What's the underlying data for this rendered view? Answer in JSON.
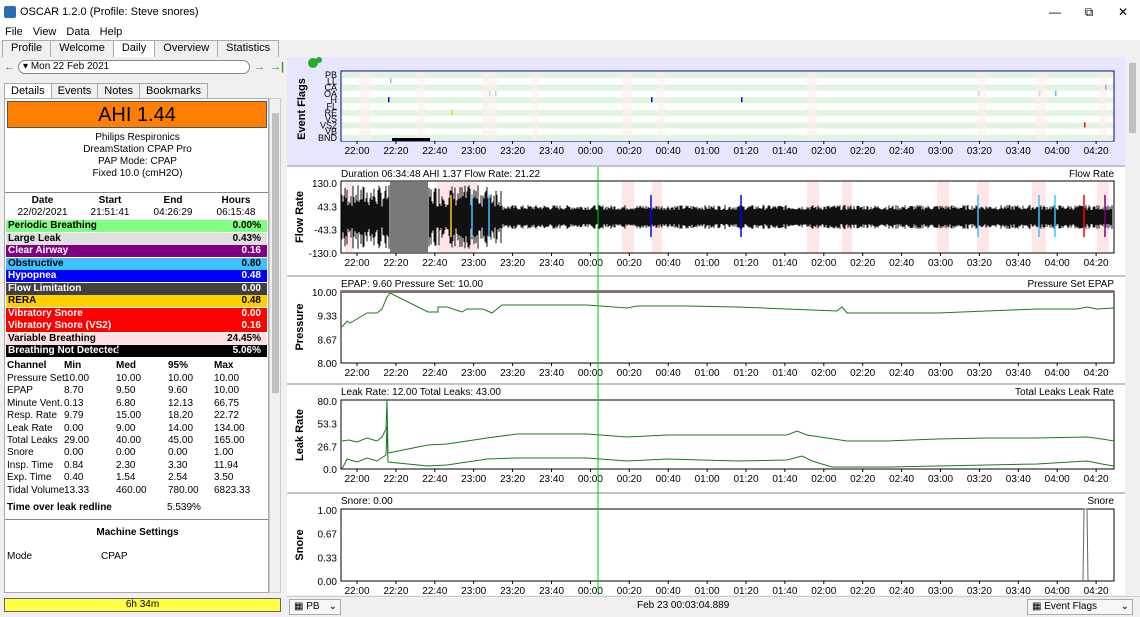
{
  "window": {
    "title": "OSCAR 1.2.0 (Profile: Steve snores)",
    "minimize": "—",
    "maximize": "⧉",
    "close": "✕"
  },
  "menu": [
    "File",
    "View",
    "Data",
    "Help"
  ],
  "main_tabs": [
    "Profile",
    "Welcome",
    "Daily",
    "Overview",
    "Statistics"
  ],
  "date_nav": {
    "back": "←",
    "date": "Mon 22 Feb 2021",
    "forward": "→",
    "last": "→|"
  },
  "detail_tabs": [
    "Details",
    "Events",
    "Notes",
    "Bookmarks"
  ],
  "ahi_label": "AHI 1.44",
  "machine": {
    "brand": "Philips Respironics",
    "model": "DreamStation CPAP Pro",
    "mode": "PAP Mode: CPAP",
    "pressure": "Fixed 10.0 (cmH2O)"
  },
  "session": {
    "headers": [
      "Date",
      "Start",
      "End",
      "Hours"
    ],
    "values": [
      "22/02/2021",
      "21:51:41",
      "04:26:29",
      "06:15:48"
    ]
  },
  "events": [
    {
      "name": "Periodic Breathing",
      "value": "0.00%",
      "bg": "#80ff80",
      "fg": "#000000"
    },
    {
      "name": "Large Leak",
      "value": "0.43%",
      "bg": "#e0e0e0",
      "fg": "#000000"
    },
    {
      "name": "Clear Airway",
      "value": "0.16",
      "bg": "#800080",
      "fg": "#ffffff"
    },
    {
      "name": "Obstructive",
      "value": "0.80",
      "bg": "#40c0ff",
      "fg": "#000000"
    },
    {
      "name": "Hypopnea",
      "value": "0.48",
      "bg": "#0000ff",
      "fg": "#ffffff"
    },
    {
      "name": "Flow Limitation",
      "value": "0.00",
      "bg": "#404040",
      "fg": "#ffffff"
    },
    {
      "name": "RERA",
      "value": "0.48",
      "bg": "#ffd000",
      "fg": "#000000"
    },
    {
      "name": "Vibratory Snore",
      "value": "0.00",
      "bg": "#ff0000",
      "fg": "#ffffff"
    },
    {
      "name": "Vibratory Snore (VS2)",
      "value": "0.16",
      "bg": "#ff0000",
      "fg": "#ffffff"
    },
    {
      "name": "Variable Breathing",
      "value": "24.45%",
      "bg": "#ffe0e0",
      "fg": "#000000"
    },
    {
      "name": "Breathing Not Detected",
      "value": "5.06%",
      "bg": "#000000",
      "fg": "#ffffff"
    }
  ],
  "statistics": {
    "title": "Statistics",
    "headers": [
      "Channel",
      "Min",
      "Med",
      "95%",
      "Max"
    ],
    "rows": [
      [
        "Pressure Set",
        "10.00",
        "10.00",
        "10.00",
        "10.00"
      ],
      [
        "EPAP",
        "8.70",
        "9.50",
        "9.60",
        "10.00"
      ],
      [
        "Minute Vent.",
        "0.13",
        "6.80",
        "12.13",
        "66.75"
      ],
      [
        "Resp. Rate",
        "9.79",
        "15.00",
        "18.20",
        "22.72"
      ],
      [
        "Leak Rate",
        "0.00",
        "9.00",
        "14.00",
        "134.00"
      ],
      [
        "Total Leaks",
        "29.00",
        "40.00",
        "45.00",
        "165.00"
      ],
      [
        "Snore",
        "0.00",
        "0.00",
        "0.00",
        "1.00"
      ],
      [
        "Insp. Time",
        "0.84",
        "2.30",
        "3.30",
        "11.94"
      ],
      [
        "Exp. Time",
        "0.40",
        "1.54",
        "2.54",
        "3.50"
      ],
      [
        "Tidal Volume",
        "13.33",
        "460.00",
        "780.00",
        "6823.33"
      ]
    ],
    "leak_redline_label": "Time over leak redline",
    "leak_redline_value": "5.539%",
    "machine_settings_title": "Machine Settings",
    "mode_label": "Mode",
    "mode_value": "CPAP"
  },
  "usage_bar": "6h 34m",
  "time_ticks": [
    "22:00",
    "22:20",
    "22:40",
    "23:00",
    "23:20",
    "23:40",
    "00:00",
    "00:20",
    "00:40",
    "01:00",
    "01:20",
    "01:40",
    "02:00",
    "02:20",
    "02:40",
    "03:00",
    "03:20",
    "03:40",
    "04:00",
    "04:20"
  ],
  "graphs": {
    "event_flags": {
      "title": "Event Flags",
      "rows": [
        "PB",
        "LL",
        "CA",
        "OA",
        "H",
        "FL",
        "RE",
        "VS",
        "VS2",
        "VB",
        "BND"
      ]
    },
    "flow": {
      "title": "Flow Rate",
      "header": "Duration 06:34:48 AHI 1.37 Flow Rate: 21.22",
      "legend": "Flow Rate",
      "yticks": [
        "130.0",
        "43.3",
        "-43.3",
        "-130.0"
      ]
    },
    "pressure": {
      "title": "Pressure",
      "header": "EPAP: 9.60 Pressure Set: 10.00",
      "legend": "Pressure Set  EPAP",
      "yticks": [
        "10.00",
        "9.33",
        "8.67",
        "8.00"
      ]
    },
    "leak": {
      "title": "Leak Rate",
      "header": "Leak Rate: 12.00 Total Leaks: 43.00",
      "legend": "Total Leaks  Leak Rate",
      "yticks": [
        "80.0",
        "53.3",
        "26.7",
        "0.0"
      ]
    },
    "snore": {
      "title": "Snore",
      "header": "Snore: 0.00",
      "legend": "Snore",
      "yticks": [
        "1.00",
        "0.67",
        "0.33",
        "0.00"
      ]
    }
  },
  "statusbar": {
    "left_select": "PB",
    "center": "Feb 23 00:03:04.889",
    "right_select": "Event Flags"
  },
  "colors": {
    "ahi_bg": "#ff8000",
    "cursor_line": "#00cc00",
    "trace_green": "#1a7a1a",
    "usage_bar": "#ffff44"
  }
}
